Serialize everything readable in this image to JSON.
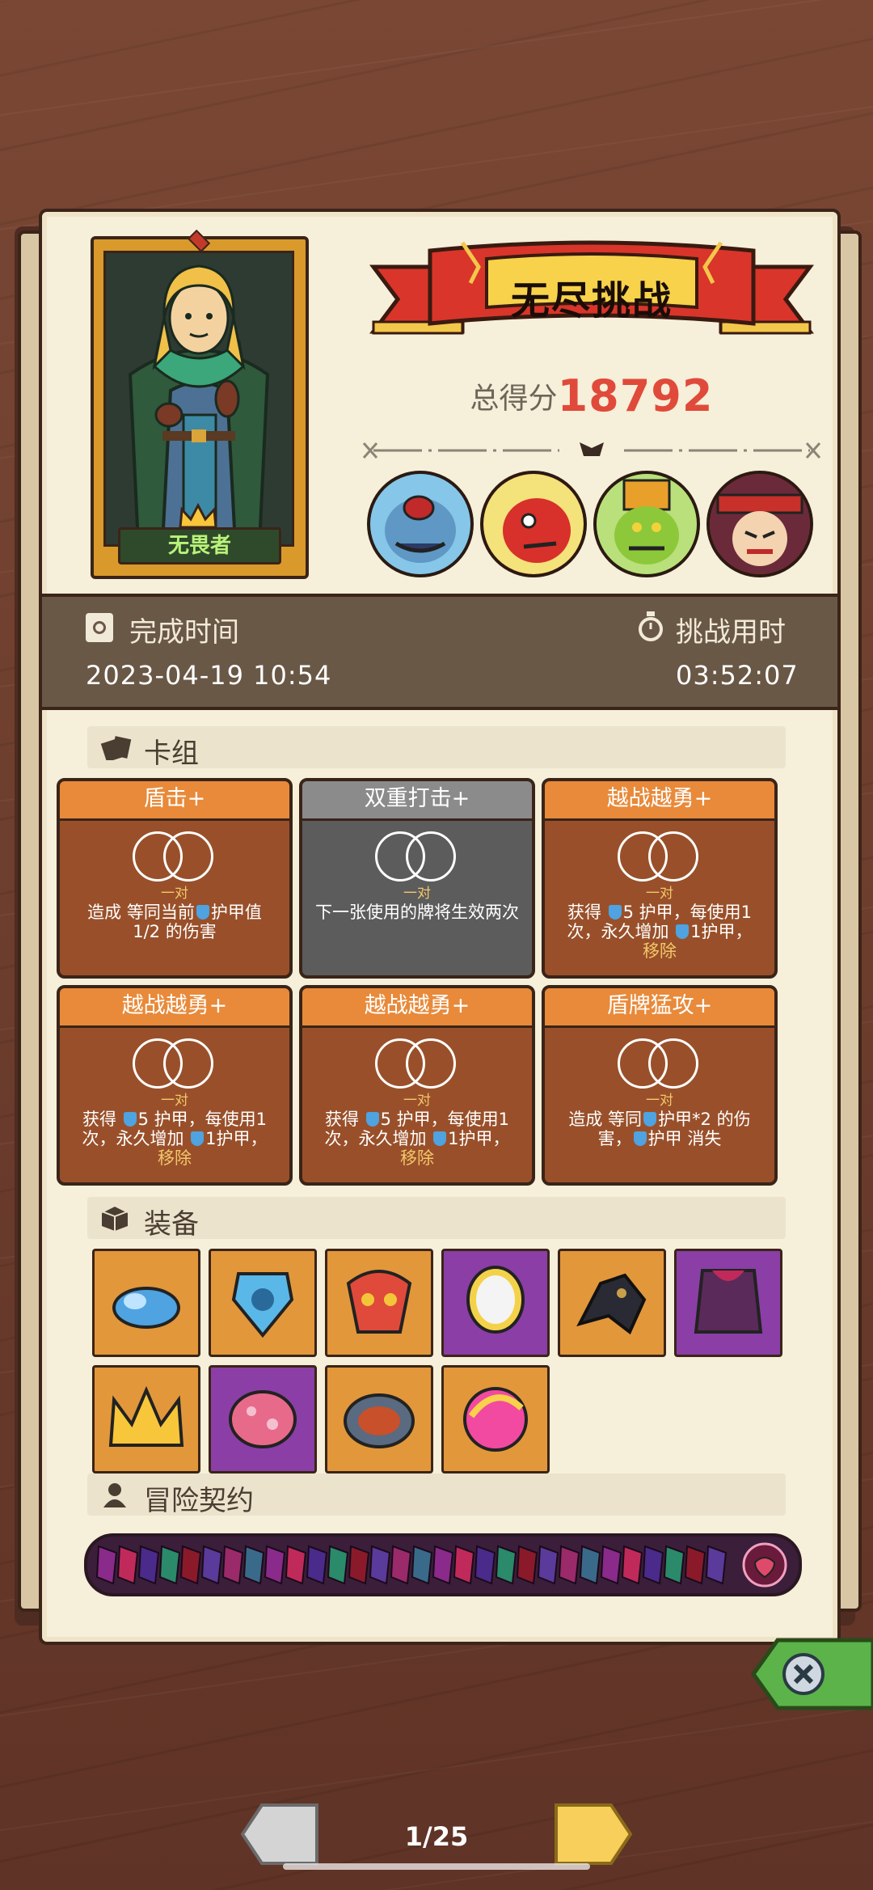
{
  "hero": {
    "name": "无畏者"
  },
  "mode": {
    "title": "无尽挑战"
  },
  "score": {
    "label": "总得分",
    "value": "18792"
  },
  "info": {
    "finish_label": "完成时间",
    "finish_value": "2023-04-19  10:54",
    "duration_label": "挑战用时",
    "duration_value": "03:52:07"
  },
  "deck": {
    "title": "卡组",
    "cards": [
      {
        "name": "盾击+",
        "sub": "一对",
        "style": "orange",
        "desc_pre": "造成 等同当前",
        "desc_post": "护甲值 1/2 的伤害",
        "extra": ""
      },
      {
        "name": "双重打击+",
        "sub": "一对",
        "style": "grey",
        "desc_pre": "下一张使用的牌将生效两次",
        "desc_post": "",
        "extra": ""
      },
      {
        "name": "越战越勇+",
        "sub": "一对",
        "style": "orange",
        "desc_pre": "获得 ",
        "desc_post": "5 护甲，每使用1次，永久增加 ",
        "desc_tail": "1护甲，",
        "extra": "移除"
      },
      {
        "name": "越战越勇+",
        "sub": "一对",
        "style": "orange",
        "desc_pre": "获得 ",
        "desc_post": "5 护甲，每使用1次，永久增加 ",
        "desc_tail": "1护甲，",
        "extra": "移除"
      },
      {
        "name": "越战越勇+",
        "sub": "一对",
        "style": "orange",
        "desc_pre": "获得 ",
        "desc_post": "5 护甲，每使用1次，永久增加 ",
        "desc_tail": "1护甲，",
        "extra": "移除"
      },
      {
        "name": "盾牌猛攻+",
        "sub": "一对",
        "style": "orange",
        "desc_pre": "造成 等同",
        "desc_post": "护甲*2 的伤害，",
        "desc_tail": "护甲 消失",
        "extra": ""
      }
    ]
  },
  "equipment": {
    "title": "装备",
    "items": [
      {
        "icon": "blue-slime-icon",
        "rarity": "orange"
      },
      {
        "icon": "ice-shield-icon",
        "rarity": "orange"
      },
      {
        "icon": "tribal-mask-icon",
        "rarity": "orange"
      },
      {
        "icon": "golden-mirror-icon",
        "rarity": "purple"
      },
      {
        "icon": "dark-claw-icon",
        "rarity": "orange"
      },
      {
        "icon": "studded-armor-icon",
        "rarity": "purple"
      },
      {
        "icon": "golden-crown-icon",
        "rarity": "orange"
      },
      {
        "icon": "spotted-egg-icon",
        "rarity": "purple"
      },
      {
        "icon": "bronze-disc-icon",
        "rarity": "orange"
      },
      {
        "icon": "pink-orb-icon",
        "rarity": "orange"
      }
    ]
  },
  "contract": {
    "title": "冒险契约"
  },
  "pager": {
    "text": "1/25"
  },
  "colors": {
    "score": "#e04a3a",
    "card_orange": "#99502a",
    "card_head": "#e88a3a",
    "equip_orange": "#e2973b",
    "equip_purple": "#8b3ea6"
  }
}
